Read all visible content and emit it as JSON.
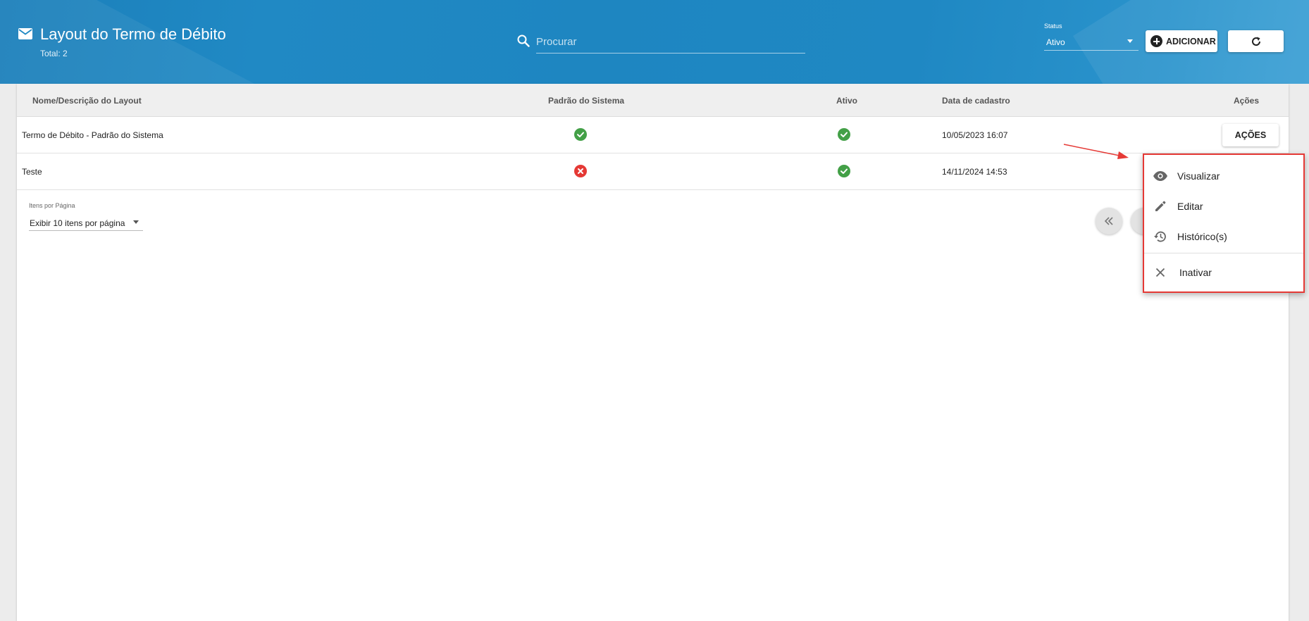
{
  "header": {
    "title": "Layout do Termo de Débito",
    "total": "Total: 2",
    "search_placeholder": "Procurar",
    "status_label": "Status",
    "status_value": "Ativo",
    "add_label": "ADICIONAR",
    "bg_color": "#1f88c3"
  },
  "table": {
    "headers": {
      "name": "Nome/Descrição do Layout",
      "system_default": "Padrão do Sistema",
      "active": "Ativo",
      "created": "Data de cadastro",
      "actions": "Ações"
    },
    "rows": [
      {
        "name": "Termo de Débito - Padrão do Sistema",
        "system_default": "check-circle-icon",
        "active": "check-circle-icon",
        "created": "10/05/2023 16:07",
        "actions_label": "AÇÕES"
      },
      {
        "name": "Teste",
        "system_default": "cancel-circle-icon",
        "active": "check-circle-icon",
        "created": "14/11/2024 14:53"
      }
    ]
  },
  "pagination": {
    "per_page_label": "Itens por Página",
    "per_page_value": "Exibir 10 itens por página"
  },
  "actions_menu": {
    "items": [
      {
        "label": "Visualizar",
        "icon": "eye-icon"
      },
      {
        "label": "Editar",
        "icon": "pencil-icon"
      },
      {
        "label": "Histórico(s)",
        "icon": "history-icon"
      },
      {
        "label": "Inativar",
        "icon": "close-icon"
      }
    ],
    "highlight_color": "#e53935"
  },
  "colors": {
    "success": "#43a047",
    "error": "#e53935"
  }
}
